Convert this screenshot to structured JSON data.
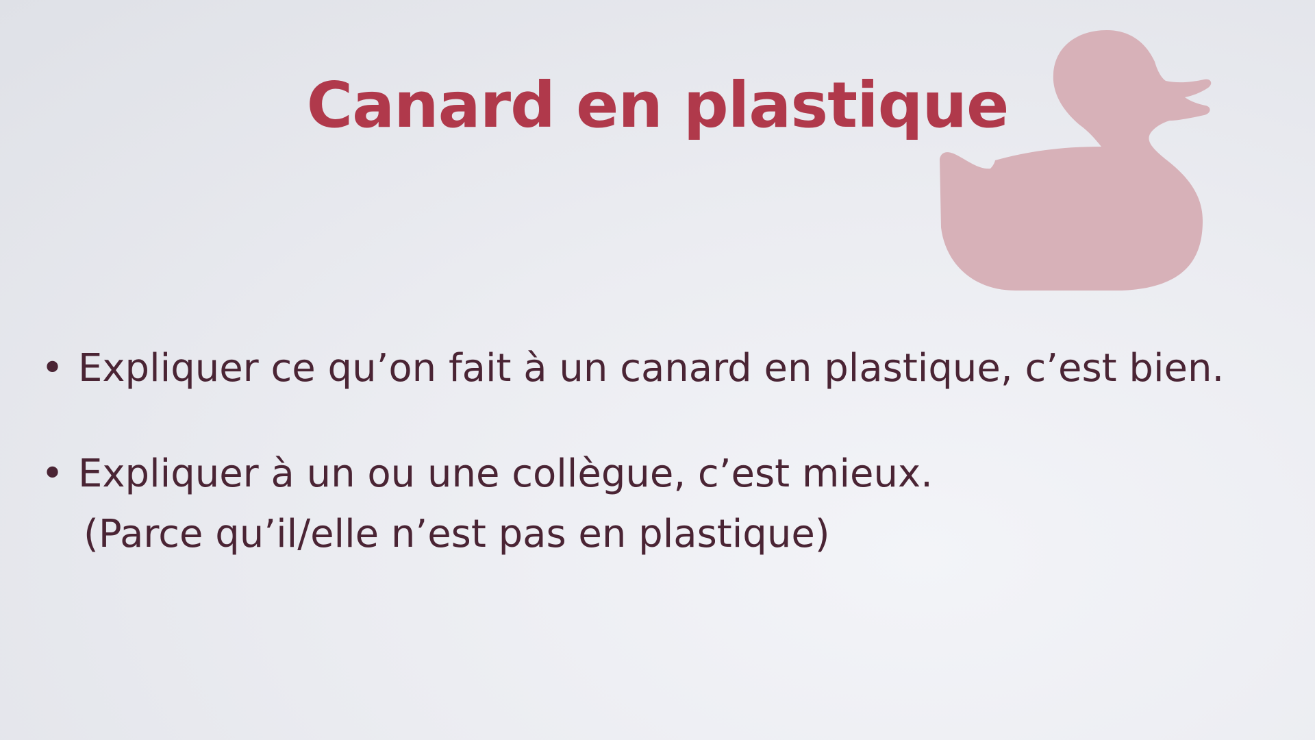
{
  "slide": {
    "title": "Canard en plastique",
    "decoration": {
      "icon": "rubber-duck-icon",
      "color": "#d7b1b8"
    },
    "bullets": [
      {
        "marker": "•",
        "text": "Expliquer ce qu’on fait à un canard en plastique, c’est bien."
      },
      {
        "marker": "•",
        "text": "Expliquer à un ou une collègue, c’est mieux.",
        "subline": "(Parce qu’il/elle n’est pas en plastique)"
      }
    ],
    "colors": {
      "title": "#b0394b",
      "body": "#4a2434",
      "background": "#eceef2"
    }
  }
}
